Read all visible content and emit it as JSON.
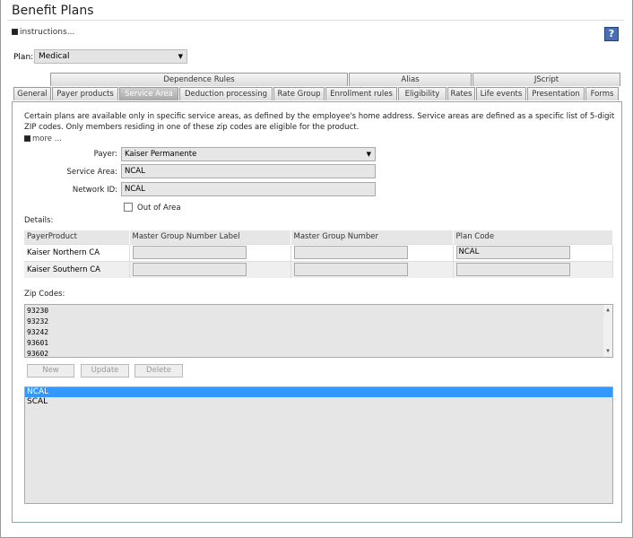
{
  "title": "Benefit Plans",
  "instructions_link": "instructions...",
  "help_label": "?",
  "plan": {
    "label": "Plan:",
    "value": "Medical"
  },
  "tabs_row1": [
    {
      "label": "Dependence Rules"
    },
    {
      "label": "Alias"
    },
    {
      "label": "JScript"
    }
  ],
  "tabs_row2": [
    {
      "label": "General"
    },
    {
      "label": "Payer products"
    },
    {
      "label": "Service Area",
      "active": true
    },
    {
      "label": "Deduction processing"
    },
    {
      "label": "Rate Group"
    },
    {
      "label": "Enrollment rules"
    },
    {
      "label": "Eligibility"
    },
    {
      "label": "Rates"
    },
    {
      "label": "Life events"
    },
    {
      "label": "Presentation"
    },
    {
      "label": "Forms"
    }
  ],
  "service_area": {
    "description": "Certain plans are available only in specific service areas, as defined by the employee's home address. Service areas are defined as a specific list of 5-digit ZIP codes. Only members residing in one of these zip codes are eligible for the product.",
    "more_link": "more ...",
    "payer_label": "Payer:",
    "payer_value": "Kaiser Permanente",
    "service_area_label": "Service Area:",
    "service_area_value": "NCAL",
    "network_id_label": "Network ID:",
    "network_id_value": "NCAL",
    "out_of_area_label": "Out of Area",
    "out_of_area_checked": false
  },
  "details": {
    "label": "Details:",
    "columns": [
      "PayerProduct",
      "Master Group Number Label",
      "Master Group Number",
      "Plan Code"
    ],
    "rows": [
      {
        "payer_product": "Kaiser Northern CA",
        "mgn_label": "",
        "mgn": "",
        "plan_code": "NCAL"
      },
      {
        "payer_product": "Kaiser Southern CA",
        "mgn_label": "",
        "mgn": "",
        "plan_code": ""
      }
    ]
  },
  "zip_codes": {
    "label": "Zip Codes:",
    "values": [
      "93230",
      "93232",
      "93242",
      "93601",
      "93602"
    ]
  },
  "buttons": {
    "new": "New",
    "update": "Update",
    "delete": "Delete"
  },
  "service_areas_list": [
    {
      "label": "NCAL",
      "selected": true
    },
    {
      "label": "SCAL",
      "selected": false
    }
  ]
}
